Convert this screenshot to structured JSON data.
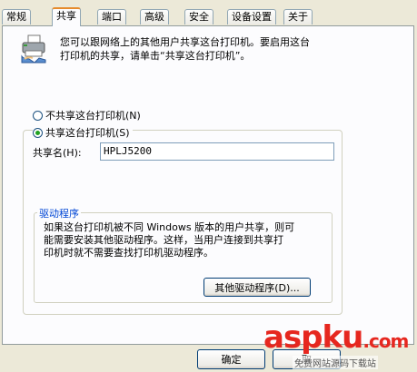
{
  "tabs": [
    {
      "label": "常规",
      "active": false
    },
    {
      "label": "共享",
      "active": true
    },
    {
      "label": "端口",
      "active": false
    },
    {
      "label": "高级",
      "active": false
    },
    {
      "label": "安全",
      "active": false
    },
    {
      "label": "设备设置",
      "active": false
    },
    {
      "label": "关于",
      "active": false
    }
  ],
  "intro": {
    "line1": "您可以跟网络上的其他用户共享这台打印机。要启用这台",
    "line2": "打印机的共享，请单击“共享这台打印机”。"
  },
  "sharing": {
    "not_share_label": "不共享这台打印机(N)",
    "share_label": "共享这台打印机(S)",
    "selected": "share",
    "share_name_label": "共享名(H):",
    "share_name_value": "HPLJ5200"
  },
  "drivers": {
    "title": "驱动程序",
    "text_line1": "如果这台打印机被不同 Windows 版本的用户共享，则可",
    "text_line2": "能需要安装其他驱动程序。这样，当用户连接到共享打",
    "text_line3": "印机时就不需要查找打印机驱动程序。",
    "button_label": "其他驱动程序(D)..."
  },
  "footer": {
    "ok_label": "确定",
    "cancel_label": "取"
  },
  "watermark": {
    "asp": "asp",
    "ku": "ku",
    "net": ".com",
    "subtitle": "免费网站源码下载站"
  },
  "icons": {
    "printer": "printer-share-icon"
  },
  "colors": {
    "dialog_bg": "#ece9d8",
    "panel_bg": "#fcfcfe",
    "active_tab_accent": "#e68b2c",
    "group_title": "#0046d5",
    "watermark_red": "#e6271f"
  }
}
